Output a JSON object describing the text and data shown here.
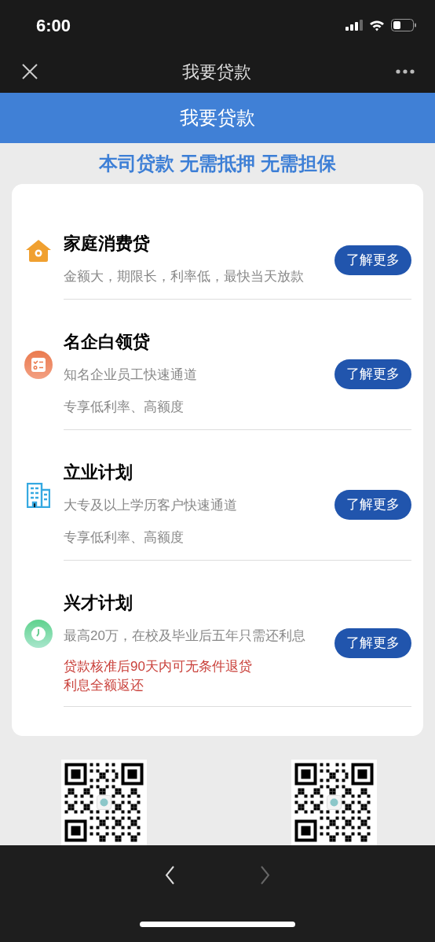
{
  "status_bar": {
    "time": "6:00"
  },
  "nav_bar": {
    "title": "我要贷款"
  },
  "header": {
    "title": "我要贷款"
  },
  "tagline": "本司贷款 无需抵押 无需担保",
  "products": [
    {
      "kind": "house",
      "title": "家庭消费贷",
      "lines": [
        {
          "text": "金额大，期限长，利率低，最快当天放款",
          "kind": "note"
        }
      ],
      "button": "了解更多"
    },
    {
      "kind": "checklist",
      "title": "名企白领贷",
      "lines": [
        {
          "text": "知名企业员工快速通道",
          "kind": "note"
        },
        {
          "text": "专享低利率、高额度",
          "kind": "note"
        }
      ],
      "button": "了解更多"
    },
    {
      "kind": "building",
      "title": "立业计划",
      "lines": [
        {
          "text": "大专及以上学历客户快速通道",
          "kind": "note"
        },
        {
          "text": "专享低利率、高额度",
          "kind": "note"
        }
      ],
      "button": "了解更多"
    },
    {
      "kind": "clock",
      "title": "兴才计划",
      "lines": [
        {
          "text": "最高20万，在校及毕业后五年只需还利息",
          "kind": "note"
        },
        {
          "text": "贷款核准后90天内可无条件退贷",
          "kind": "warning"
        },
        {
          "text": "利息全额返还",
          "kind": "warning"
        }
      ],
      "button": "了解更多"
    }
  ],
  "qr_codes": [
    {
      "kind": "qr"
    },
    {
      "kind": "qr"
    }
  ],
  "toolbar": [
    {
      "kind": "back",
      "disabled": false
    },
    {
      "kind": "forward",
      "disabled": true
    }
  ]
}
